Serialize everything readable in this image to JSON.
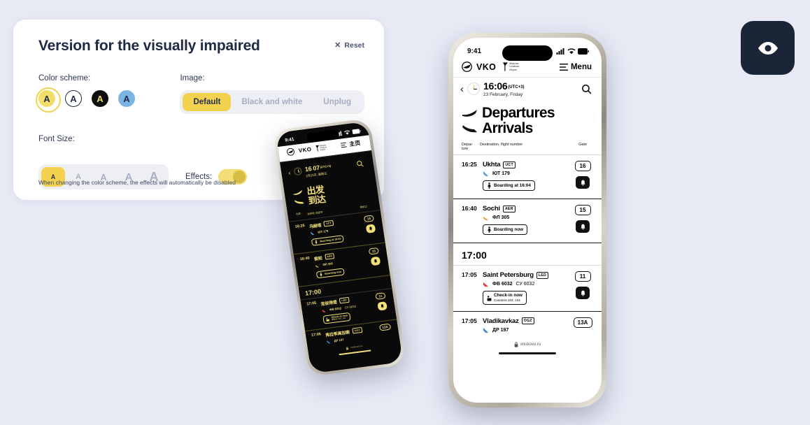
{
  "panel": {
    "title": "Version for the visually impaired",
    "reset_label": "Reset",
    "reset_icon": "close-icon",
    "color_scheme_label": "Color scheme:",
    "color_schemes": [
      {
        "name": "yellow",
        "letter": "A",
        "bg": "#f3dd6a",
        "fg": "#1e2a44",
        "selected": true
      },
      {
        "name": "white",
        "letter": "A",
        "bg": "#ffffff",
        "fg": "#1e2a44",
        "selected": false
      },
      {
        "name": "black",
        "letter": "A",
        "bg": "#0d0d0d",
        "fg": "#f3dd6a",
        "selected": false
      },
      {
        "name": "blue",
        "letter": "A",
        "bg": "#7bb4e3",
        "fg": "#1e2a44",
        "selected": false
      }
    ],
    "image_label": "Image:",
    "image_options": [
      {
        "label": "Default",
        "active": true
      },
      {
        "label": "Black and white",
        "active": false
      },
      {
        "label": "Unplug",
        "active": false
      }
    ],
    "font_size_label": "Font Size:",
    "font_sizes": [
      {
        "label": "A",
        "size": "9px",
        "active": true
      },
      {
        "label": "A",
        "size": "11px",
        "active": false
      },
      {
        "label": "A",
        "size": "13px",
        "active": false
      },
      {
        "label": "A",
        "size": "15px",
        "active": false
      },
      {
        "label": "A",
        "size": "18px",
        "active": false
      }
    ],
    "effects_label": "Effects:",
    "effects_on": true,
    "footnote": "When changing the color scheme, the effects will automatically be disabled"
  },
  "eye_button": {
    "icon": "eye-icon",
    "bg": "#1b2538"
  },
  "phone_large": {
    "theme": "light",
    "status": {
      "time": "9:41",
      "signal_icon": "cellular-signal-icon",
      "wifi_icon": "wifi-icon",
      "battery_icon": "battery-icon"
    },
    "header": {
      "logo_icon": "vko-plane-logo-icon",
      "brand": "VKO",
      "brand_sub": "Moscow\nVnukovo\nAirport",
      "menu_icon": "hamburger-icon",
      "menu_label": "Menu"
    },
    "clock": {
      "back_icon": "chevron-left-icon",
      "time": "16:06",
      "utc": "(UTC+3)",
      "date": "23 February, Friday",
      "search_icon": "search-icon"
    },
    "titles": [
      {
        "icon": "departure-plane-icon",
        "label": "Departures"
      },
      {
        "icon": "arrival-plane-icon",
        "label": "Arrivals"
      }
    ],
    "columns": {
      "departure": "Depar-\nture",
      "destination": "Destination, flight number",
      "gate": "Gate"
    },
    "flights": [
      {
        "time": "16:25",
        "destination": "Ukhta",
        "code": "UCT",
        "airline_icon": "airline-logo-icon",
        "flight_no": "ЮТ 179",
        "alt_flight_no": "",
        "badge_icon": "boarding-icon",
        "badge": "Boarding at 16:04",
        "badge_sub": "",
        "gate": "16",
        "bell_icon": "bell-icon"
      },
      {
        "time": "16:40",
        "destination": "Sochi",
        "code": "AER",
        "airline_icon": "airline-logo-icon",
        "flight_no": "ФЛ 305",
        "alt_flight_no": "",
        "badge_icon": "boarding-icon",
        "badge": "Boarding now",
        "badge_sub": "",
        "gate": "15",
        "bell_icon": "bell-icon"
      }
    ],
    "time_group": "17:00",
    "flights_group": [
      {
        "time": "17:05",
        "destination": "Saint Petersburg",
        "code": "LED",
        "airline_icon": "airline-logo-icon",
        "flight_no": "ФВ 6032",
        "alt_flight_no": "СУ 6032",
        "badge_icon": "check-in-icon",
        "badge": "Check-in now",
        "badge_sub": "Counters 103, 104",
        "gate": "11",
        "bell_icon": "bell-icon"
      },
      {
        "time": "17:05",
        "destination": "Vladikavkaz",
        "code": "OGZ",
        "airline_icon": "airline-logo-icon",
        "flight_no": "ДР 197",
        "alt_flight_no": "",
        "badge_icon": "",
        "badge": "",
        "badge_sub": "",
        "gate": "13A",
        "bell_icon": ""
      }
    ],
    "url": {
      "lock_icon": "lock-icon",
      "text": "vnukovo.ru"
    }
  },
  "phone_small": {
    "theme": "dark",
    "status": {
      "time": "9:41",
      "signal_icon": "cellular-signal-icon",
      "wifi_icon": "wifi-icon",
      "battery_icon": "battery-icon"
    },
    "header": {
      "logo_icon": "vko-plane-logo-icon",
      "brand": "VKO",
      "brand_sub": "Moscow\nVnukovo\nAirport",
      "menu_icon": "hamburger-icon",
      "menu_label": "主页"
    },
    "clock": {
      "back_icon": "chevron-left-icon",
      "time": "16 07",
      "utc": "(UTC+3)",
      "date": "2月23日, 星期五",
      "search_icon": "search-icon"
    },
    "titles": [
      {
        "icon": "departure-plane-icon",
        "label": "出发"
      },
      {
        "icon": "arrival-plane-icon",
        "label": "到达"
      }
    ],
    "columns": {
      "departure": "出发",
      "destination": "目的地, 航班号",
      "gate": "登机口"
    },
    "flights": [
      {
        "time": "16:25",
        "destination": "乌赫塔",
        "code": "UCT",
        "airline_icon": "airline-logo-icon",
        "flight_no": "ЮТ 179",
        "alt_flight_no": "",
        "badge_icon": "boarding-icon",
        "badge": "Boarding at 16:04",
        "badge_sub": "",
        "gate": "16",
        "bell_icon": "bell-icon"
      },
      {
        "time": "16:40",
        "destination": "索契",
        "code": "AER",
        "airline_icon": "airline-logo-icon",
        "flight_no": "ФЛ 305",
        "alt_flight_no": "",
        "badge_icon": "boarding-icon",
        "badge": "Boarding now",
        "badge_sub": "",
        "gate": "15",
        "bell_icon": "bell-icon"
      }
    ],
    "time_group": "17:00",
    "flights_group": [
      {
        "time": "17:05",
        "destination": "圣彼得堡",
        "code": "LED",
        "airline_icon": "airline-logo-icon",
        "flight_no": "ФВ 6032",
        "alt_flight_no": "СУ 6032",
        "badge_icon": "check-in-icon",
        "badge": "Check-in now",
        "badge_sub": "服务台 103, 104",
        "gate": "11",
        "bell_icon": "bell-icon"
      },
      {
        "time": "17:05",
        "destination": "弗拉季高加索",
        "code": "OGZ",
        "airline_icon": "airline-logo-icon",
        "flight_no": "ДР 197",
        "alt_flight_no": "",
        "badge_icon": "",
        "badge": "",
        "badge_sub": "",
        "gate": "13A",
        "bell_icon": ""
      }
    ],
    "url": {
      "lock_icon": "lock-icon",
      "text": "vnukovo.ru"
    }
  }
}
